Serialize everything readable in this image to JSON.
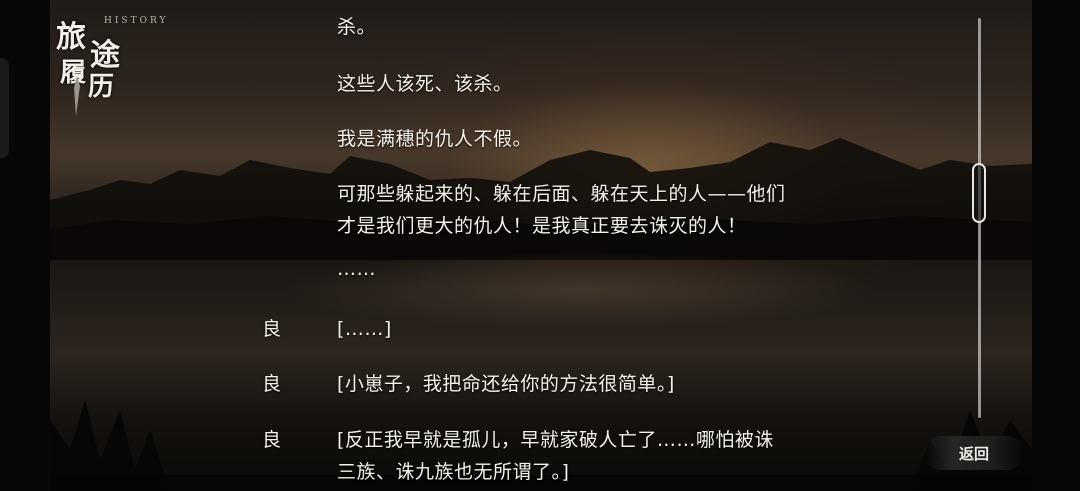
{
  "logo": {
    "label": "HISTORY",
    "chars": [
      "旅",
      "途",
      "履",
      "历"
    ]
  },
  "entries": [
    {
      "speaker": "",
      "lines": [
        "杀。"
      ]
    },
    {
      "speaker": "",
      "lines": [
        "这些人该死、该杀。"
      ]
    },
    {
      "speaker": "",
      "lines": [
        "我是满穗的仇人不假。"
      ]
    },
    {
      "speaker": "",
      "lines": [
        "可那些躲起来的、躲在后面、躲在天上的人——他们",
        "才是我们更大的仇人！是我真正要去诛灭的人！"
      ]
    },
    {
      "speaker": "",
      "lines": [
        "……"
      ]
    },
    {
      "speaker": "良",
      "lines": [
        "[……]"
      ]
    },
    {
      "speaker": "良",
      "lines": [
        "[小崽子，我把命还给你的方法很简单。]"
      ]
    },
    {
      "speaker": "良",
      "lines": [
        "[反正我早就是孤儿，早就家破人亡了……哪怕被诛",
        "三族、诛九族也无所谓了。]"
      ]
    }
  ],
  "back_button": {
    "label": "返回"
  },
  "colors": {
    "text": "#f4f1ea",
    "scroll": "#e9e6e0"
  }
}
